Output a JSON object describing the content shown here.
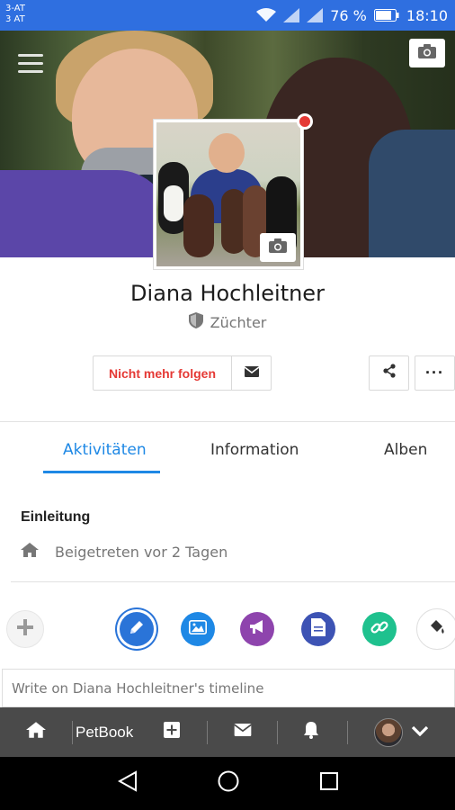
{
  "status_bar": {
    "carrier_line1": "3-AT",
    "carrier_line2": "3 AT",
    "battery": "76 %",
    "time": "18:10"
  },
  "profile": {
    "name": "Diana Hochleitner",
    "role": "Züchter"
  },
  "actions": {
    "unfollow_label": "Nicht mehr folgen",
    "more_label": "···"
  },
  "tabs": [
    {
      "label": "Aktivitäten",
      "active": true
    },
    {
      "label": "Information",
      "active": false
    },
    {
      "label": "Alben",
      "active": false
    }
  ],
  "intro": {
    "title": "Einleitung",
    "joined": "Beigetreten vor 2 Tagen"
  },
  "composer": {
    "placeholder": "Write on Diana Hochleitner's timeline"
  },
  "app_bar": {
    "brand": "PetBook"
  },
  "colors": {
    "status_bar": "#2f6fe0",
    "accent": "#1e88e5",
    "unfollow": "#e53935",
    "app_bar": "#4a4a4a"
  }
}
